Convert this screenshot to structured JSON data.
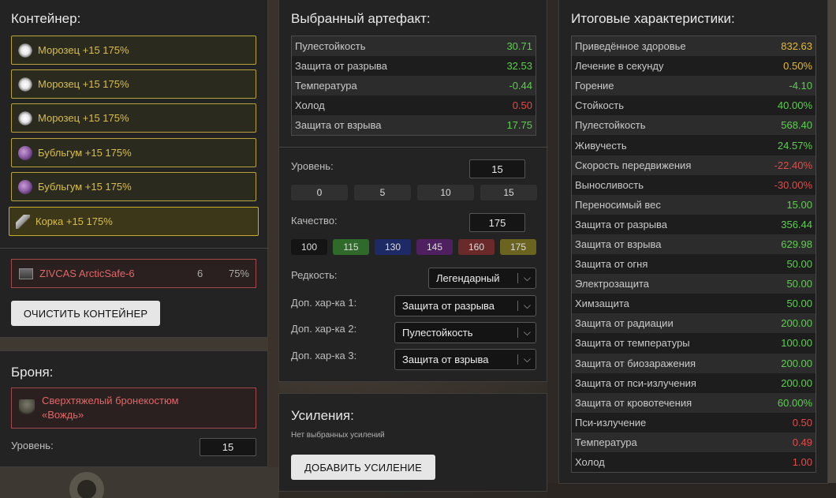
{
  "container": {
    "title": "Контейнер:",
    "slots": [
      {
        "label": "Морозец +15 175%",
        "icon": "frost-artifact-icon"
      },
      {
        "label": "Морозец +15 175%",
        "icon": "frost-artifact-icon"
      },
      {
        "label": "Морозец +15 175%",
        "icon": "frost-artifact-icon"
      },
      {
        "label": "Бубльгум +15 175%",
        "icon": "bubblegum-artifact-icon"
      },
      {
        "label": "Бубльгум +15 175%",
        "icon": "bubblegum-artifact-icon"
      },
      {
        "label": "Корка +15 175%",
        "icon": "crust-artifact-icon"
      }
    ],
    "item": {
      "name": "ZIVCAS ArcticSafe-6",
      "slots": "6",
      "protection": "75%"
    },
    "clear_button": "ОЧИСТИТЬ КОНТЕЙНЕР"
  },
  "armor": {
    "title": "Броня:",
    "item_name": "Сверхтяжелый бронекостюм «Вождь»",
    "level_label": "Уровень:",
    "level_value": "15"
  },
  "artifact": {
    "title": "Выбранный артефакт:",
    "stats": [
      {
        "name": "Пулестойкость",
        "value": "30.71",
        "color": "green"
      },
      {
        "name": "Защита от разрыва",
        "value": "32.53",
        "color": "green"
      },
      {
        "name": "Температура",
        "value": "-0.44",
        "color": "green"
      },
      {
        "name": "Холод",
        "value": "0.50",
        "color": "red"
      },
      {
        "name": "Защита от взрыва",
        "value": "17.75",
        "color": "green"
      }
    ],
    "level_label": "Уровень:",
    "level_value": "15",
    "level_presets": [
      "0",
      "5",
      "10",
      "15"
    ],
    "quality_label": "Качество:",
    "quality_value": "175",
    "quality_presets": [
      {
        "label": "100",
        "color": "#141414"
      },
      {
        "label": "115",
        "color": "#2f6a2b"
      },
      {
        "label": "130",
        "color": "#1d2a66"
      },
      {
        "label": "145",
        "color": "#4e2060"
      },
      {
        "label": "160",
        "color": "#6a2a2a"
      },
      {
        "label": "175",
        "color": "#6b6420"
      }
    ],
    "rarity_label": "Редкость:",
    "rarity_value": "Легендарный",
    "extra1_label": "Доп. хар-ка 1:",
    "extra1_value": "Защита от разрыва",
    "extra2_label": "Доп. хар-ка 2:",
    "extra2_value": "Пулестойкость",
    "extra3_label": "Доп. хар-ка 3:",
    "extra3_value": "Защита от взрыва"
  },
  "boosts": {
    "title": "Усиления:",
    "empty_text": "Нет выбранных усилений",
    "add_button": "ДОБАВИТЬ УСИЛЕНИЕ"
  },
  "totals": {
    "title": "Итоговые характеристики:",
    "stats": [
      {
        "name": "Приведённое здоровье",
        "value": "832.63",
        "color": "yellow"
      },
      {
        "name": "Лечение в секунду",
        "value": "0.50%",
        "color": "yellow"
      },
      {
        "name": "Горение",
        "value": "-4.10",
        "color": "green"
      },
      {
        "name": "Стойкость",
        "value": "40.00%",
        "color": "green"
      },
      {
        "name": "Пулестойкость",
        "value": "568.40",
        "color": "green"
      },
      {
        "name": "Живучесть",
        "value": "24.57%",
        "color": "green"
      },
      {
        "name": "Скорость передвижения",
        "value": "-22.40%",
        "color": "red"
      },
      {
        "name": "Выносливость",
        "value": "-30.00%",
        "color": "red"
      },
      {
        "name": "Переносимый вес",
        "value": "15.00",
        "color": "green"
      },
      {
        "name": "Защита от разрыва",
        "value": "356.44",
        "color": "green"
      },
      {
        "name": "Защита от взрыва",
        "value": "629.98",
        "color": "green"
      },
      {
        "name": "Защита от огня",
        "value": "50.00",
        "color": "green"
      },
      {
        "name": "Электрозащита",
        "value": "50.00",
        "color": "green"
      },
      {
        "name": "Химзащита",
        "value": "50.00",
        "color": "green"
      },
      {
        "name": "Защита от радиации",
        "value": "200.00",
        "color": "green"
      },
      {
        "name": "Защита от температуры",
        "value": "100.00",
        "color": "green"
      },
      {
        "name": "Защита от биозаражения",
        "value": "200.00",
        "color": "green"
      },
      {
        "name": "Защита от пси-излучения",
        "value": "200.00",
        "color": "green"
      },
      {
        "name": "Защита от кровотечения",
        "value": "60.00%",
        "color": "green"
      },
      {
        "name": "Пси-излучение",
        "value": "0.50",
        "color": "red"
      },
      {
        "name": "Температура",
        "value": "0.49",
        "color": "red"
      },
      {
        "name": "Холод",
        "value": "1.00",
        "color": "red"
      }
    ]
  }
}
